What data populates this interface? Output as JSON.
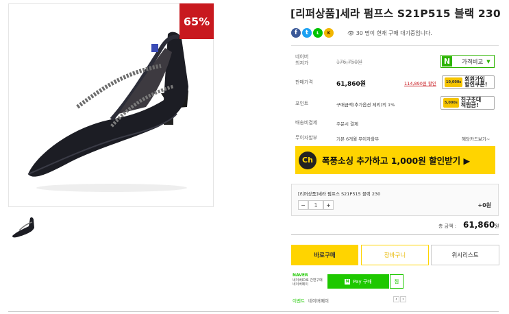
{
  "product": {
    "discount_badge": "65%",
    "title": "[리퍼상품]세라 펌프스 S21P515 블랙 230",
    "viewers_text": "30 명이 현재 구매 대기중입니다."
  },
  "share": {
    "icons": [
      "facebook-icon",
      "twitter-icon",
      "line-icon",
      "kakaostory-icon"
    ]
  },
  "info": {
    "msrp_label": "네이버\n최저가",
    "msrp_value": "176,750원",
    "compare_label": "가격비교",
    "sale_label": "판매가격",
    "sale_value": "61,860원",
    "alt_price": "114,890원 할인",
    "coupon1_tag": "10,000s",
    "coupon1_text": "회원가입\n할인쿠폰!",
    "point_label": "포인트",
    "point_value": "구매금액(추가옵션 제외)의 1%",
    "coupon2_tag": "5,000s",
    "coupon2_text": "친구초대\n적립금!",
    "shipping_label": "배송비결제",
    "shipping_value": "주문시 결제",
    "installment_label": "무이자할부",
    "installment_value": "기본 6개월 무이자할부",
    "card_benefit": "해당카드보기~"
  },
  "banner": {
    "logo": "Ch",
    "text": "폭풍소싱 추가하고 1,000원 할인받기 ▶"
  },
  "option": {
    "name": "[리퍼상품]세라 펌프스 S21P515 블랙 230",
    "minus": "−",
    "qty": "1",
    "plus": "+",
    "extra": "+0원"
  },
  "total": {
    "label": "총 금액 :",
    "value": "61,860",
    "unit": "원"
  },
  "buttons": {
    "buy": "바로구매",
    "cart": "장바구니",
    "wish": "위시리스트"
  },
  "npay": {
    "brand": "NAVER",
    "desc": "네이버ID로 간편구매\n네이버페이",
    "pay_label": "Pay 구매",
    "side_label": "찜",
    "event_label": "이벤트",
    "event_text": "네이버페이",
    "pager_prev": "‹",
    "pager_next": "›"
  },
  "colors": {
    "accent_yellow": "#ffd400",
    "naver_green": "#2db400",
    "discount_red": "#c8191f"
  }
}
